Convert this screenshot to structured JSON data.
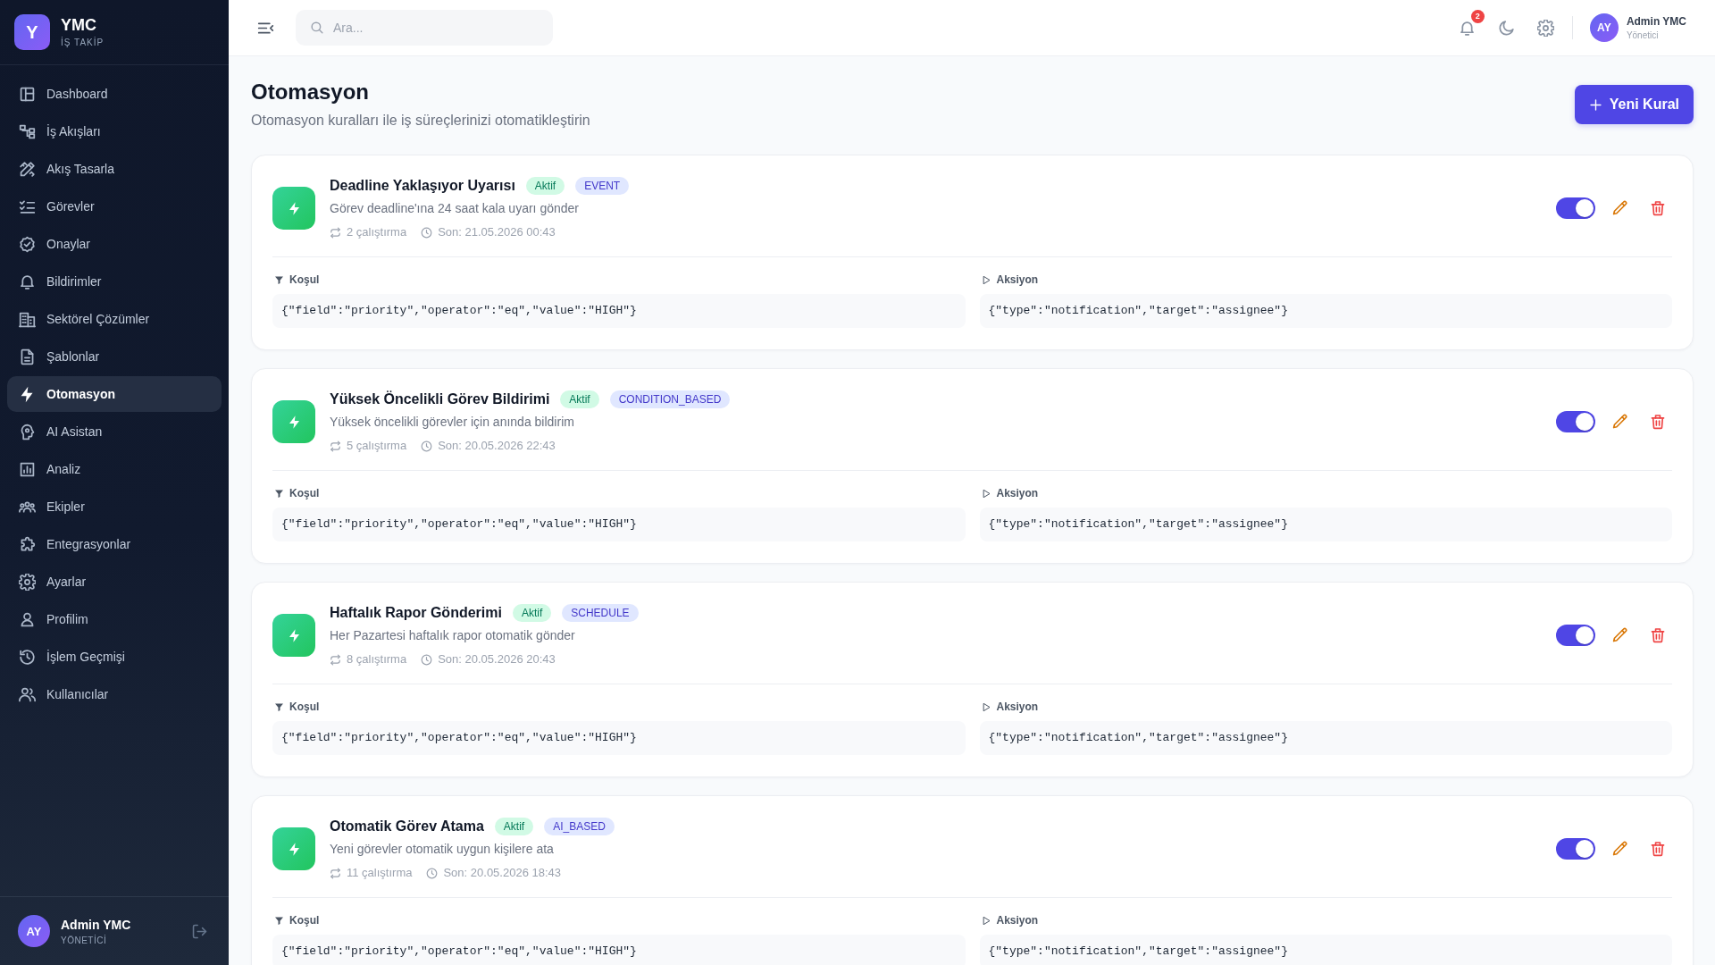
{
  "sidebar": {
    "logo": "Y",
    "brand": "YMC",
    "tagline": "İŞ TAKİP",
    "items": [
      {
        "label": "Dashboard",
        "selected": false
      },
      {
        "label": "İş Akışları",
        "selected": false
      },
      {
        "label": "Akış Tasarla",
        "selected": false
      },
      {
        "label": "Görevler",
        "selected": false
      },
      {
        "label": "Onaylar",
        "selected": false
      },
      {
        "label": "Bildirimler",
        "selected": false
      },
      {
        "label": "Sektörel Çözümler",
        "selected": false
      },
      {
        "label": "Şablonlar",
        "selected": false
      },
      {
        "label": "Otomasyon",
        "selected": true
      },
      {
        "label": "AI Asistan",
        "selected": false
      },
      {
        "label": "Analiz",
        "selected": false
      },
      {
        "label": "Ekipler",
        "selected": false
      },
      {
        "label": "Entegrasyonlar",
        "selected": false
      },
      {
        "label": "Ayarlar",
        "selected": false
      },
      {
        "label": "Profilim",
        "selected": false
      },
      {
        "label": "İşlem Geçmişi",
        "selected": false
      },
      {
        "label": "Kullanıcılar",
        "selected": false
      }
    ],
    "user": {
      "initials": "AY",
      "name": "Admin YMC",
      "role": "YÖNETİCİ"
    }
  },
  "topbar": {
    "search": {
      "placeholder": "Ara..."
    },
    "notification_count": "2",
    "user": {
      "initials": "AY",
      "name": "Admin YMC",
      "role": "Yönetici"
    }
  },
  "header": {
    "title": "Otomasyon",
    "subtitle": "Otomasyon kuralları ile iş süreçlerinizi otomatikleştirin",
    "new_button": "Yeni Kural"
  },
  "rules": [
    {
      "name": "Deadline Yaklaşıyor Uyarısı",
      "status": "Aktif",
      "trigger": "EVENT",
      "description": "Görev deadline'ına 24 saat kala uyarı gönder",
      "runs": "2 çalıştırma",
      "last_run": "Son: 21.05.2026 00:43",
      "enabled": true,
      "condition_label": "Koşul",
      "condition": "{\"field\":\"priority\",\"operator\":\"eq\",\"value\":\"HIGH\"}",
      "action_label": "Aksiyon",
      "action": "{\"type\":\"notification\",\"target\":\"assignee\"}"
    },
    {
      "name": "Yüksek Öncelikli Görev Bildirimi",
      "status": "Aktif",
      "trigger": "CONDITION_BASED",
      "description": "Yüksek öncelikli görevler için anında bildirim",
      "runs": "5 çalıştırma",
      "last_run": "Son: 20.05.2026 22:43",
      "enabled": true,
      "condition_label": "Koşul",
      "condition": "{\"field\":\"priority\",\"operator\":\"eq\",\"value\":\"HIGH\"}",
      "action_label": "Aksiyon",
      "action": "{\"type\":\"notification\",\"target\":\"assignee\"}"
    },
    {
      "name": "Haftalık Rapor Gönderimi",
      "status": "Aktif",
      "trigger": "SCHEDULE",
      "description": "Her Pazartesi haftalık rapor otomatik gönder",
      "runs": "8 çalıştırma",
      "last_run": "Son: 20.05.2026 20:43",
      "enabled": true,
      "condition_label": "Koşul",
      "condition": "{\"field\":\"priority\",\"operator\":\"eq\",\"value\":\"HIGH\"}",
      "action_label": "Aksiyon",
      "action": "{\"type\":\"notification\",\"target\":\"assignee\"}"
    },
    {
      "name": "Otomatik Görev Atama",
      "status": "Aktif",
      "trigger": "AI_BASED",
      "description": "Yeni görevler otomatik uygun kişilere ata",
      "runs": "11 çalıştırma",
      "last_run": "Son: 20.05.2026 18:43",
      "enabled": true,
      "condition_label": "Koşul",
      "condition": "{\"field\":\"priority\",\"operator\":\"eq\",\"value\":\"HIGH\"}",
      "action_label": "Aksiyon",
      "action": "{\"type\":\"notification\",\"target\":\"assignee\"}"
    }
  ]
}
